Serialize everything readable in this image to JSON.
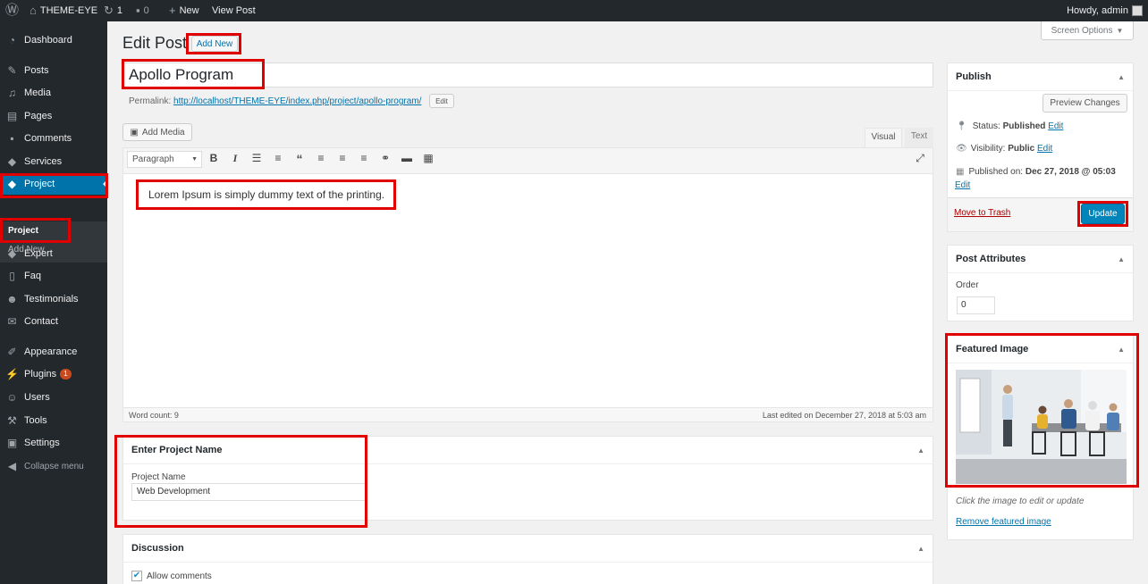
{
  "adminbar": {
    "site_name": "THEME-EYE",
    "updates_count": "1",
    "comments_count": "0",
    "new_label": "New",
    "view_post_label": "View Post",
    "howdy": "Howdy, admin"
  },
  "sidebar": {
    "items": [
      {
        "label": "Dashboard",
        "icon": "dashboard-icon"
      },
      {
        "label": "Posts",
        "icon": "pin-icon"
      },
      {
        "label": "Media",
        "icon": "media-icon"
      },
      {
        "label": "Pages",
        "icon": "pages-icon"
      },
      {
        "label": "Comments",
        "icon": "comments-icon"
      },
      {
        "label": "Services",
        "icon": "tag-icon"
      },
      {
        "label": "Project",
        "icon": "tag-icon"
      },
      {
        "label": "Expert",
        "icon": "tag-icon"
      },
      {
        "label": "Faq",
        "icon": "document-icon"
      },
      {
        "label": "Testimonials",
        "icon": "users-icon"
      },
      {
        "label": "Contact",
        "icon": "mail-icon"
      },
      {
        "label": "Appearance",
        "icon": "brush-icon"
      },
      {
        "label": "Plugins",
        "icon": "plugin-icon"
      },
      {
        "label": "Users",
        "icon": "user-icon"
      },
      {
        "label": "Tools",
        "icon": "wrench-icon"
      },
      {
        "label": "Settings",
        "icon": "settings-icon"
      }
    ],
    "submenu": {
      "project": "Project",
      "add_new": "Add New"
    },
    "plugins_badge": "1",
    "collapse": "Collapse menu"
  },
  "header": {
    "title": "Edit Post",
    "add_new": "Add New",
    "screen_options": "Screen Options"
  },
  "post": {
    "title": "Apollo Program",
    "permalink_label": "Permalink:",
    "permalink_url": "http://localhost/THEME-EYE/index.php/project/apollo-program/",
    "edit_label": "Edit"
  },
  "editor": {
    "add_media": "Add Media",
    "tab_visual": "Visual",
    "tab_text": "Text",
    "format_select": "Paragraph",
    "content": "Lorem Ipsum is simply dummy text of the printing.",
    "word_count": "Word count: 9",
    "last_edited": "Last edited on December 27, 2018 at 5:03 am"
  },
  "project_box": {
    "heading": "Enter Project Name",
    "field_label": "Project Name",
    "field_value": "Web Development"
  },
  "discussion": {
    "heading": "Discussion",
    "allow_comments": "Allow comments",
    "allow_comments_checked": true
  },
  "publish": {
    "heading": "Publish",
    "preview": "Preview Changes",
    "status_label": "Status:",
    "status_value": "Published",
    "visibility_label": "Visibility:",
    "visibility_value": "Public",
    "published_label": "Published on:",
    "published_value": "Dec 27, 2018 @ 05:03",
    "edit": "Edit",
    "trash": "Move to Trash",
    "update": "Update"
  },
  "attributes": {
    "heading": "Post Attributes",
    "order_label": "Order",
    "order_value": "0"
  },
  "featured": {
    "heading": "Featured Image",
    "hint": "Click the image to edit or update",
    "remove": "Remove featured image"
  },
  "colors": {
    "accent": "#0073aa",
    "sidebar": "#23282d",
    "highlight": "#e00000"
  }
}
